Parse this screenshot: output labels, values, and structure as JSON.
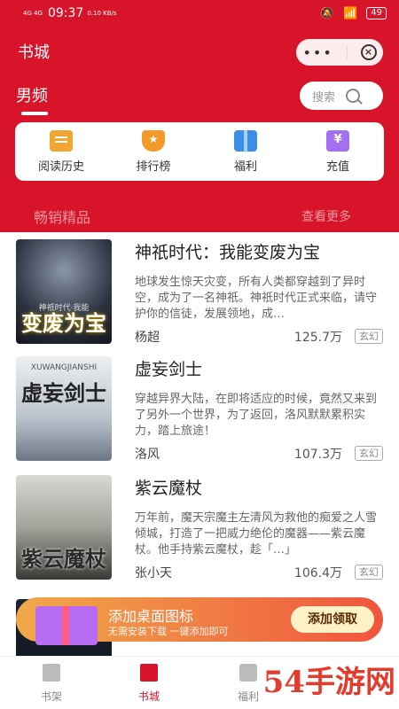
{
  "status_bar": {
    "network": "4G 4G",
    "time": "09:37",
    "speed": "0.10 KB/s",
    "battery": "49"
  },
  "header": {
    "title": "书城"
  },
  "tabs": {
    "active": "男频"
  },
  "search": {
    "placeholder": "搜索"
  },
  "quick_menu": [
    {
      "label": "阅读历史",
      "icon": "history-icon"
    },
    {
      "label": "排行榜",
      "icon": "rank-icon"
    },
    {
      "label": "福利",
      "icon": "gift-icon"
    },
    {
      "label": "充值",
      "icon": "wallet-icon"
    }
  ],
  "section": {
    "title": "畅销精品",
    "more": "查看更多"
  },
  "books": [
    {
      "title": "神祇时代：我能变废为宝",
      "description": "地球发生惊天灾变，所有人类都穿越到了异时空，成为了一名神祇。神祇时代正式来临，请守护你的信徒，发展领地，成…",
      "author": "杨超",
      "words": "125.7万",
      "tag": "玄幻",
      "cover_text": "变废为宝",
      "cover_small": "神祇时代·我能"
    },
    {
      "title": "虚妄剑士",
      "description": "穿越异界大陆，在即将适应的时候，竟然又来到了另外一个世界，为了返回，洛风默默累积实力，踏上旅途！",
      "author": "洛风",
      "words": "107.3万",
      "tag": "玄幻",
      "cover_text": "虚妄剑士",
      "cover_small": "XUWANGJIANSHI"
    },
    {
      "title": "紫云魔杖",
      "description": "万年前，魔天宗魔主左清风为救他的痴爱之人雪倾城，打造了一把威力绝伦的魔器——紫云魔杖。他手持紫云魔杖，趁「…」",
      "author": "张小天",
      "words": "106.4万",
      "tag": "玄幻",
      "cover_text": "紫云魔杖",
      "cover_small": ""
    }
  ],
  "banner": {
    "title": "添加桌面图标",
    "subtitle": "无需安装下载    一键添加即可",
    "button": "添加领取"
  },
  "bottom_nav": [
    {
      "label": "书架",
      "active": false
    },
    {
      "label": "书城",
      "active": true
    },
    {
      "label": "福利",
      "active": false
    }
  ],
  "watermark": "54手游网"
}
